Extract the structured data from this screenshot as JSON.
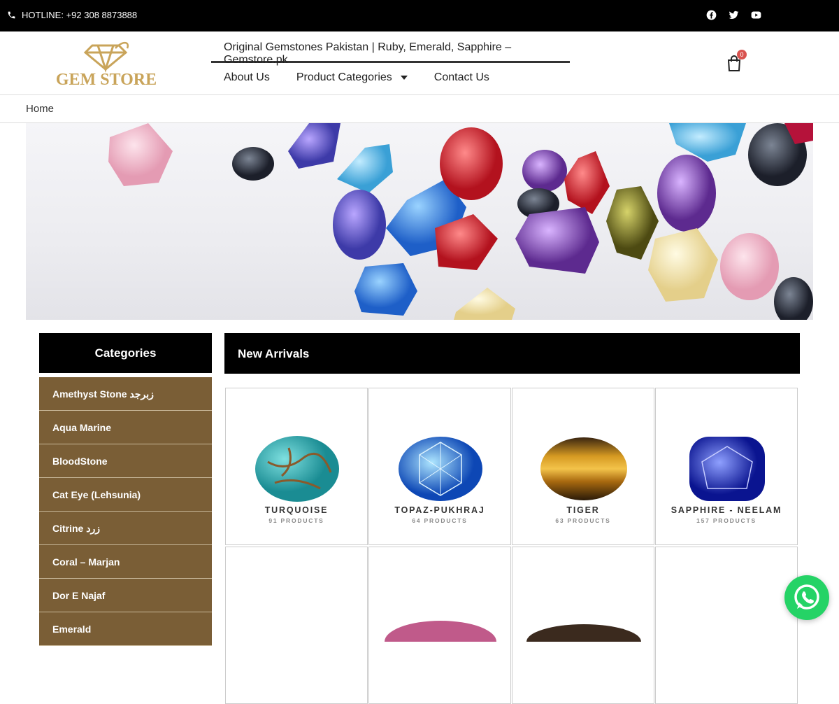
{
  "topbar": {
    "hotline": "HOTLINE: +92 308 8873888",
    "social_icons": [
      "facebook-icon",
      "twitter-icon",
      "youtube-icon"
    ]
  },
  "header": {
    "logo_text": "GEM STORE",
    "site_title": "Original Gemstones Pakistan | Ruby, Emerald, Sapphire – Gemstore.pk",
    "nav": [
      "About Us",
      "Product Categories",
      "Contact Us"
    ],
    "cart_count": "0"
  },
  "breadcrumb": {
    "home": "Home"
  },
  "sidebar": {
    "title": "Categories",
    "items": [
      "Amethyst Stone زبرجد",
      "Aqua Marine",
      "BloodStone",
      "Cat Eye (Lehsunia)",
      "Citrine زرد",
      "Coral – Marjan",
      "Dor E Najaf",
      "Emerald"
    ]
  },
  "new_arrivals": {
    "title": "New Arrivals",
    "products": [
      {
        "name": "TURQUOISE",
        "count": "91 PRODUCTS"
      },
      {
        "name": "TOPAZ-PUKHRAJ",
        "count": "64 PRODUCTS"
      },
      {
        "name": "TIGER",
        "count": "63 PRODUCTS"
      },
      {
        "name": "SAPPHIRE - NEELAM",
        "count": "157 PRODUCTS"
      }
    ]
  },
  "colors": {
    "topbar": "#000000",
    "sidebar_item": "#7a5e36",
    "logo_gold": "#c9a45a",
    "whatsapp": "#25d366",
    "cart_badge": "#d9534f"
  }
}
